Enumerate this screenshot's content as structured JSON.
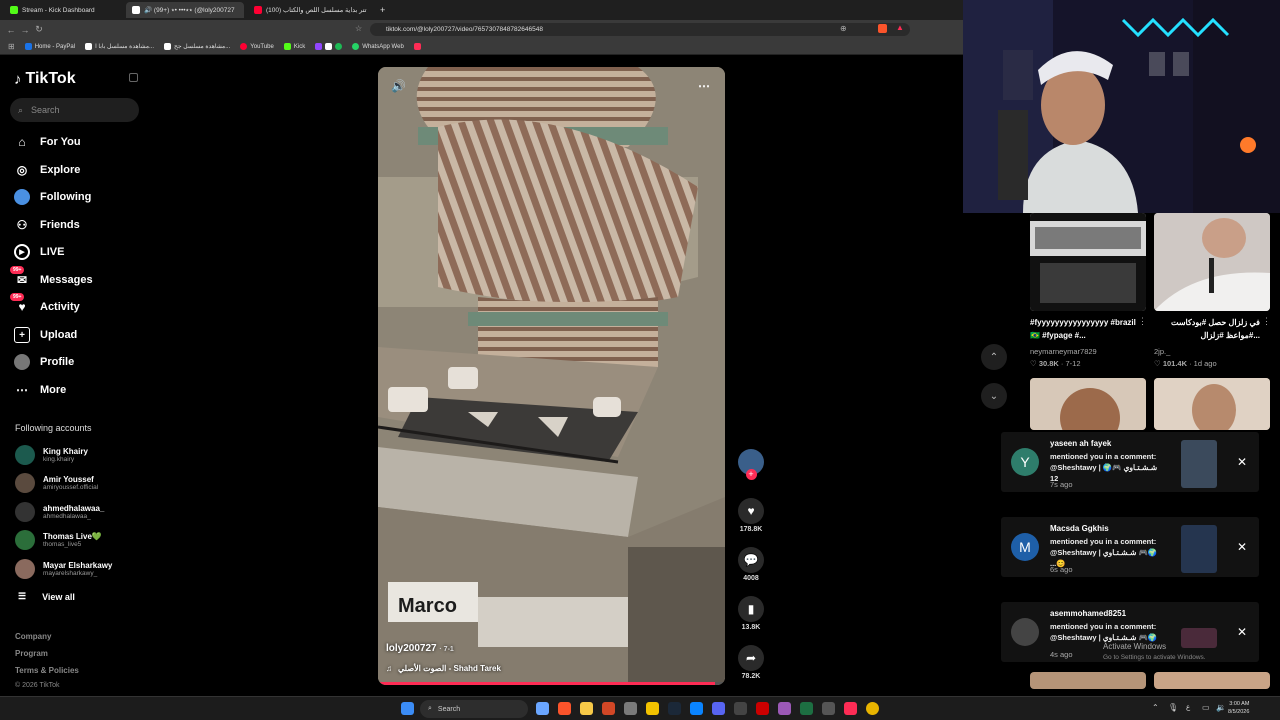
{
  "browser": {
    "tabs": [
      {
        "label": "Stream - Kick Dashboard",
        "color": "#53fc18"
      },
      {
        "label": "🔊 (99+) ٭٭••• •٭ (@loly200727",
        "color": "#ffffff"
      },
      {
        "label": "(100) تتر بداية مسلسل اللص والكتاب",
        "color": "#ff0033"
      }
    ],
    "url": "tiktok.com/@loly200727/video/7657307848782646548",
    "bookmarks": [
      {
        "label": "Home - PayPal",
        "color": "#1a73e8"
      },
      {
        "label": "مشاهدة مسلسل بابا ا...",
        "color": "#ffffff"
      },
      {
        "label": "مشاهدة مسلسل جح...",
        "color": "#ffffff"
      },
      {
        "label": "YouTube",
        "color": "#ff0033"
      },
      {
        "label": "Kick",
        "color": "#53fc18"
      },
      {
        "label": "WhatsApp Web",
        "color": "#25d366"
      }
    ]
  },
  "sidebar": {
    "logo": "TikTok",
    "search_placeholder": "Search",
    "nav": [
      {
        "label": "For You",
        "icon": "home-icon"
      },
      {
        "label": "Explore",
        "icon": "compass-icon"
      },
      {
        "label": "Following",
        "icon": "following-icon"
      },
      {
        "label": "Friends",
        "icon": "friends-icon"
      },
      {
        "label": "LIVE",
        "icon": "live-icon"
      },
      {
        "label": "Messages",
        "icon": "messages-icon",
        "badge": "99+"
      },
      {
        "label": "Activity",
        "icon": "activity-icon",
        "badge": "99+"
      },
      {
        "label": "Upload",
        "icon": "upload-icon"
      },
      {
        "label": "Profile",
        "icon": "profile-icon"
      },
      {
        "label": "More",
        "icon": "more-icon"
      }
    ],
    "following_title": "Following accounts",
    "accounts": [
      {
        "name": "King Khairy",
        "handle": "king.khairy"
      },
      {
        "name": "Amir Youssef",
        "handle": "amiryoussef.official"
      },
      {
        "name": "ahmedhalawaa_",
        "handle": "ahmedhalawaa_"
      },
      {
        "name": "Thomas Live💚",
        "handle": "thomas_live5"
      },
      {
        "name": "Mayar Elsharkawy",
        "handle": "mayarelsharkawy_"
      }
    ],
    "view_all": "View all",
    "footer": [
      "Company",
      "Program",
      "Terms & Policies"
    ],
    "copyright": "© 2026 TikTok"
  },
  "video": {
    "author": "loly200727",
    "date": "7-1",
    "sound": "الصوت الأصلي - Shahd Tarek",
    "progress": 0.97
  },
  "actions": {
    "likes": "178.8K",
    "comments": "4008",
    "saves": "13.8K",
    "shares": "78.2K"
  },
  "right_videos": [
    {
      "title": "#fyyyyyyyyyyyyyyyy #brazil🇧🇷 #fypage #...",
      "user": "neymarneymar7829",
      "likes": "30.8K",
      "date": "7-12"
    },
    {
      "title": "في زلزال حصل #بودكاست #مواعظ #زلزال...",
      "user": "2jp._",
      "likes": "101.4K",
      "date": "1d ago"
    }
  ],
  "notifications": [
    {
      "user": "yaseen ah fayek",
      "initial": "Y",
      "color": "#2e7d6b",
      "message": "mentioned you in a comment: @Sheshtawy | شـشـتـاوي 🎮🌍 12",
      "ago": "7s ago"
    },
    {
      "user": "Macsda Ggkhis",
      "initial": "M",
      "color": "#1e5fa8",
      "message": "mentioned you in a comment: @Sheshtawy | شـشـتـاوي 🎮🌍 ...😊",
      "ago": "6s ago"
    },
    {
      "user": "asemmohamed8251",
      "initial": "",
      "color": "#444444",
      "message": "mentioned you in a comment: @Sheshtawy | شـشـتـاوي 🎮🌍",
      "ago": "4s ago"
    }
  ],
  "windows_notice": {
    "line1": "Activate Windows",
    "line2": "Go to Settings to activate Windows."
  },
  "taskbar": {
    "search": "Search",
    "time": "3:00 AM",
    "date": "8/5/2026"
  }
}
